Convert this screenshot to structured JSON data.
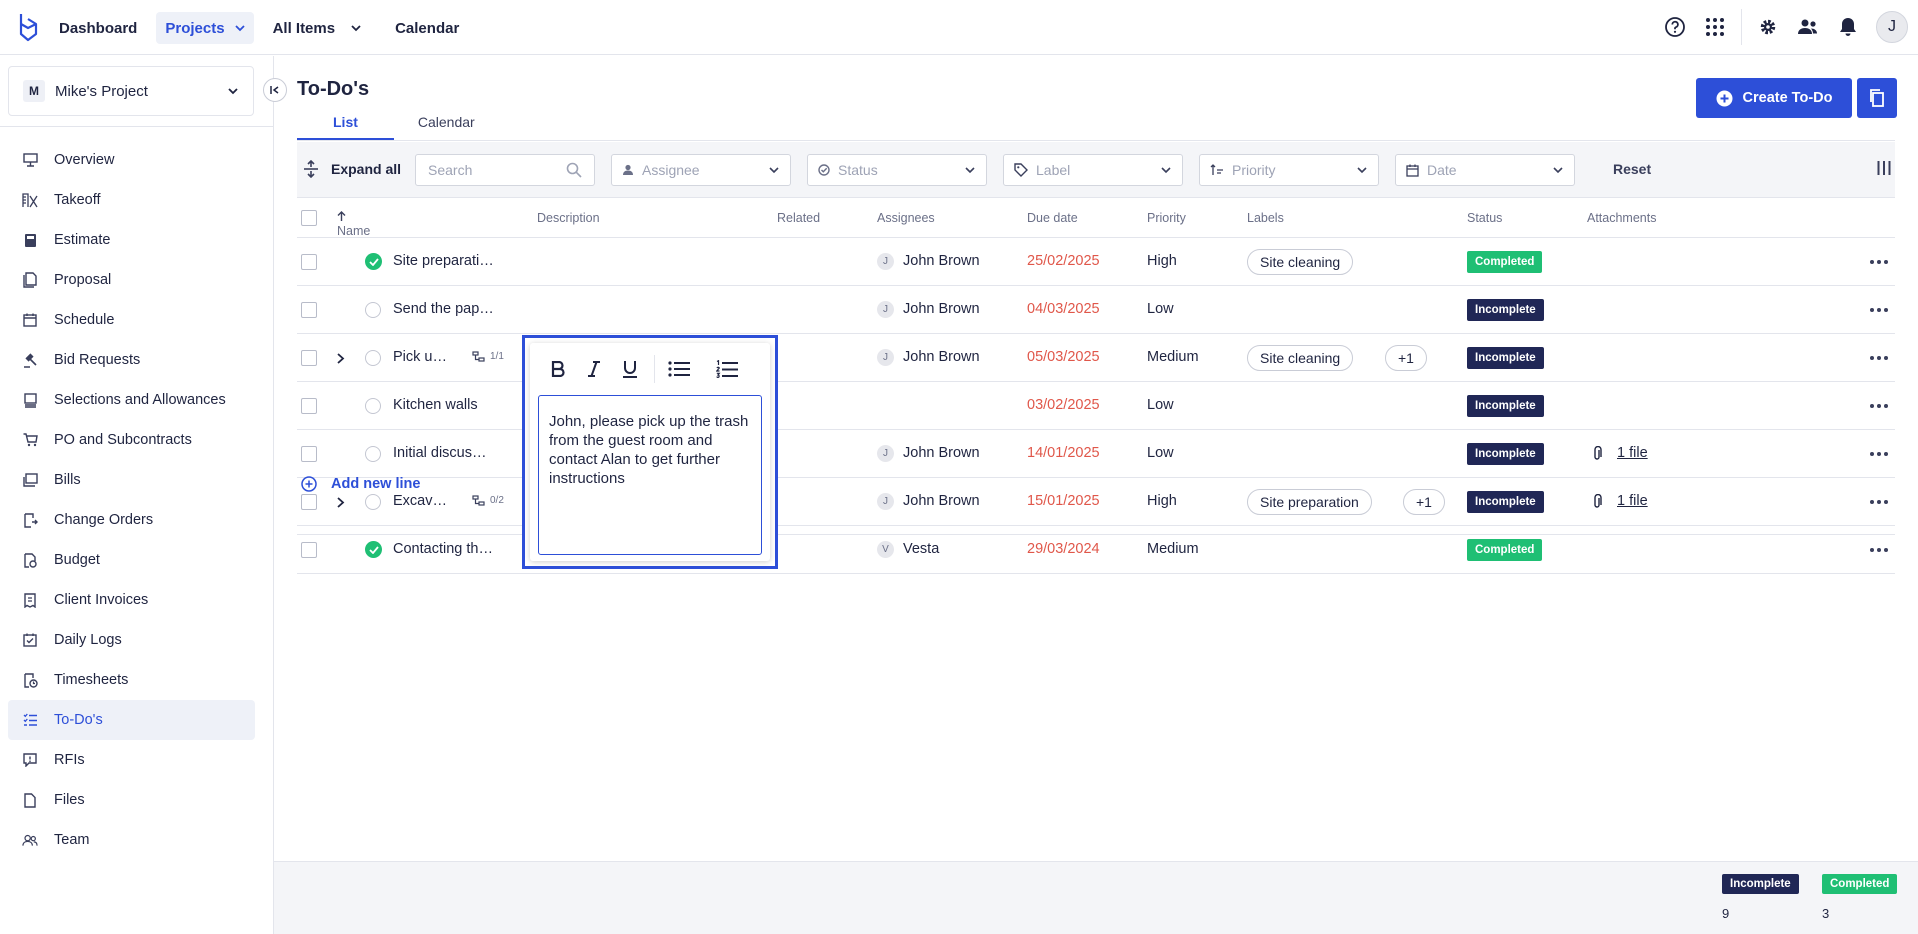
{
  "topnav": {
    "items": [
      {
        "label": "Dashboard"
      },
      {
        "label": "Projects"
      },
      {
        "label": "All Items"
      },
      {
        "label": "Calendar"
      }
    ],
    "avatar_initial": "J"
  },
  "sidebar": {
    "project": {
      "initial": "M",
      "name": "Mike's Project"
    },
    "items": [
      {
        "label": "Overview",
        "icon": "monitor-icon"
      },
      {
        "label": "Takeoff",
        "icon": "ruler-icon"
      },
      {
        "label": "Estimate",
        "icon": "calculator-icon"
      },
      {
        "label": "Proposal",
        "icon": "document-icon"
      },
      {
        "label": "Schedule",
        "icon": "calendar-icon"
      },
      {
        "label": "Bid Requests",
        "icon": "gavel-icon"
      },
      {
        "label": "Selections and Allowances",
        "icon": "stack-icon"
      },
      {
        "label": "PO and Subcontracts",
        "icon": "cart-icon"
      },
      {
        "label": "Bills",
        "icon": "bill-icon"
      },
      {
        "label": "Change Orders",
        "icon": "change-order-icon"
      },
      {
        "label": "Budget",
        "icon": "budget-icon"
      },
      {
        "label": "Client Invoices",
        "icon": "invoice-icon"
      },
      {
        "label": "Daily Logs",
        "icon": "daily-log-icon"
      },
      {
        "label": "Timesheets",
        "icon": "timesheet-icon"
      },
      {
        "label": "To-Do's",
        "icon": "todo-list-icon",
        "active": true
      },
      {
        "label": "RFIs",
        "icon": "rfi-icon"
      },
      {
        "label": "Files",
        "icon": "file-icon"
      },
      {
        "label": "Team",
        "icon": "team-icon"
      }
    ]
  },
  "page": {
    "title": "To-Do's",
    "tabs": [
      {
        "label": "List"
      },
      {
        "label": "Calendar"
      }
    ],
    "create_label": "Create To-Do"
  },
  "filters": {
    "expand_all": "Expand all",
    "search_placeholder": "Search",
    "assignee": "Assignee",
    "status": "Status",
    "label": "Label",
    "priority": "Priority",
    "date": "Date",
    "reset": "Reset"
  },
  "table": {
    "columns": {
      "name": "Name",
      "description": "Description",
      "related": "Related",
      "assignees": "Assignees",
      "due": "Due date",
      "priority": "Priority",
      "labels": "Labels",
      "status": "Status",
      "attachments": "Attachments"
    },
    "rows": [
      {
        "name": "Site preparati…",
        "done": true,
        "assignee_initial": "J",
        "assignee": "John Brown",
        "due": "25/02/2025",
        "priority": "High",
        "label": "Site cleaning",
        "status": "Completed"
      },
      {
        "name": "Send the pap…",
        "done": false,
        "assignee_initial": "J",
        "assignee": "John Brown",
        "due": "04/03/2025",
        "priority": "Low",
        "status": "Incomplete"
      },
      {
        "name": "Pick u…",
        "done": false,
        "expand": true,
        "subtasks": "1/1",
        "assignee_initial": "J",
        "assignee": "John Brown",
        "due": "05/03/2025",
        "priority": "Medium",
        "label": "Site cleaning",
        "label_more": "+1",
        "status": "Incomplete"
      },
      {
        "name": "Kitchen walls",
        "done": false,
        "due": "03/02/2025",
        "priority": "Low",
        "status": "Incomplete"
      },
      {
        "name": "Initial discus…",
        "done": false,
        "assignee_initial": "J",
        "assignee": "John Brown",
        "due": "14/01/2025",
        "priority": "Low",
        "status": "Incomplete",
        "attachment": "1 file"
      },
      {
        "name": "Excav…",
        "done": false,
        "expand": true,
        "subtasks": "0/2",
        "assignee_initial": "J",
        "assignee": "John Brown",
        "due": "15/01/2025",
        "priority": "High",
        "label": "Site preparation",
        "label_more": "+1",
        "status": "Incomplete",
        "attachment": "1 file"
      },
      {
        "name": "Contacting th…",
        "done": true,
        "assignee_initial": "V",
        "assignee": "Vesta",
        "due": "29/03/2024",
        "priority": "Medium",
        "status": "Completed"
      }
    ],
    "add_line": "Add new line"
  },
  "editor": {
    "text": "John, please pick up the trash from the guest room and contact Alan to get further instructions"
  },
  "footer": {
    "incomplete_label": "Incomplete",
    "incomplete_count": "9",
    "completed_label": "Completed",
    "completed_count": "3"
  },
  "colors": {
    "accent": "#2d4fd8",
    "incomplete": "#202756",
    "completed": "#1fbf74",
    "due": "#e0574a"
  }
}
